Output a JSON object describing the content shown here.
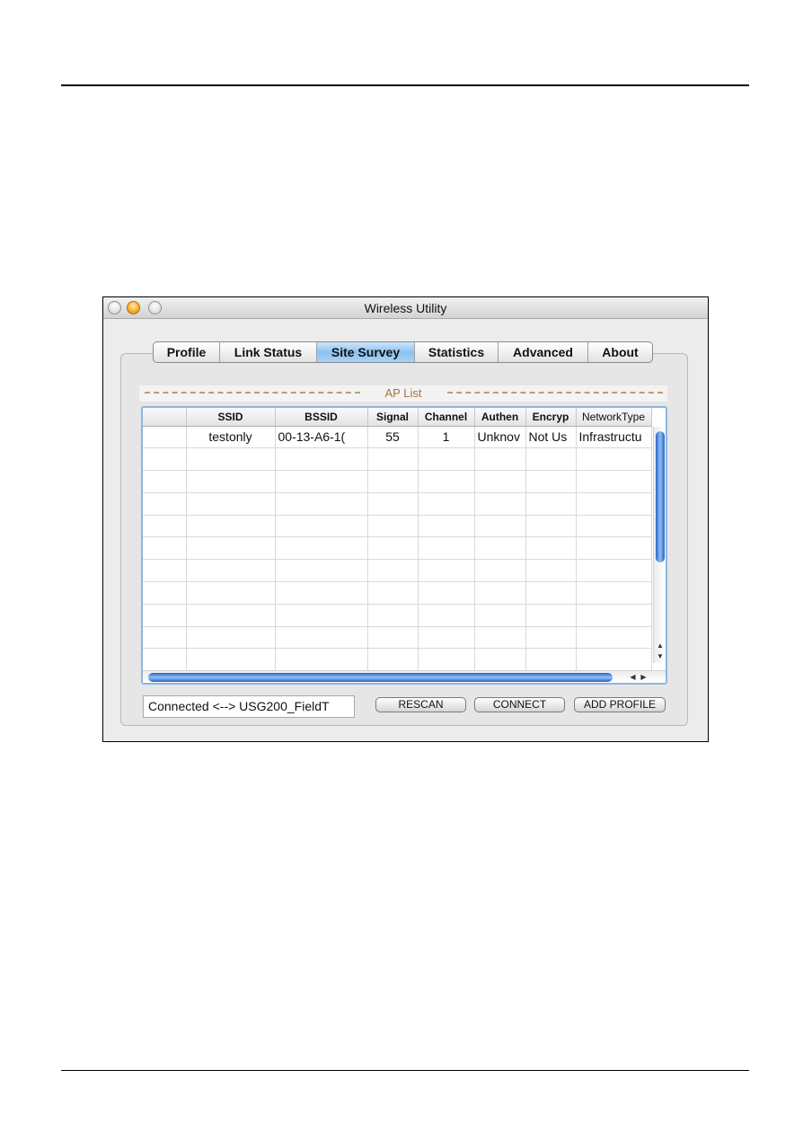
{
  "window": {
    "title": "Wireless Utility"
  },
  "tabs": [
    "Profile",
    "Link Status",
    "Site Survey",
    "Statistics",
    "Advanced",
    "About"
  ],
  "active_tab": "Site Survey",
  "ap_list": {
    "title": "AP List",
    "columns": [
      "",
      "SSID",
      "BSSID",
      "Signal",
      "Channel",
      "Authen",
      "Encryp",
      "NetworkType"
    ],
    "rows": [
      [
        "",
        "testonly",
        "00-13-A6-1(",
        "55",
        "1",
        "Unknov",
        "Not Us",
        "Infrastructu"
      ]
    ]
  },
  "status_text": "Connected <--> USG200_FieldT",
  "buttons": {
    "rescan": "RESCAN",
    "connect": "CONNECT",
    "add_profile": "ADD PROFILE"
  },
  "colors": {
    "active_tab": "#8cc2f0",
    "scrollbar": "#2a62c8",
    "ap_list_label": "#a8743a"
  }
}
